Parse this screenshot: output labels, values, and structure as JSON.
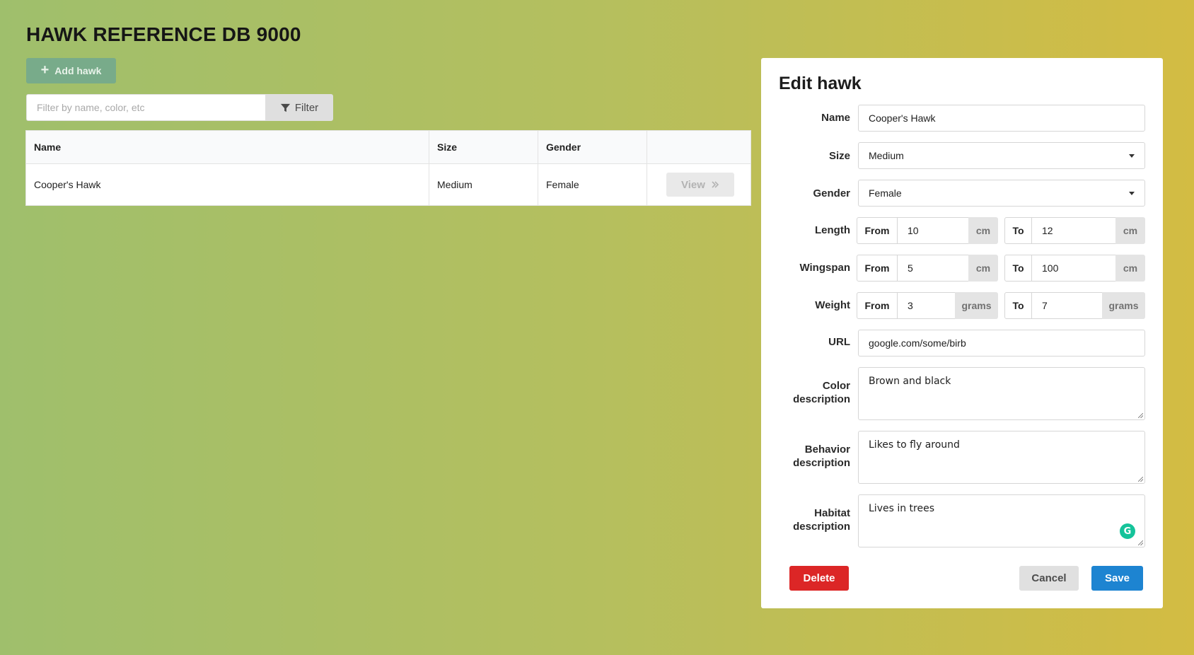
{
  "app": {
    "title": "HAWK REFERENCE DB 9000"
  },
  "toolbar": {
    "add_label": "Add hawk"
  },
  "filter": {
    "placeholder": "Filter by name, color, etc",
    "button_label": "Filter"
  },
  "table": {
    "headers": [
      "Name",
      "Size",
      "Gender",
      ""
    ],
    "rows": [
      {
        "name": "Cooper's Hawk",
        "size": "Medium",
        "gender": "Female",
        "action": "View"
      }
    ]
  },
  "edit": {
    "title": "Edit hawk",
    "labels": {
      "name": "Name",
      "size": "Size",
      "gender": "Gender",
      "length": "Length",
      "wingspan": "Wingspan",
      "weight": "Weight",
      "url": "URL",
      "color_1": "Color",
      "color_2": "description",
      "behavior_1": "Behavior",
      "behavior_2": "description",
      "habitat_1": "Habitat",
      "habitat_2": "description"
    },
    "range_labels": {
      "from": "From",
      "to": "To"
    },
    "values": {
      "name": "Cooper's Hawk",
      "size": "Medium",
      "gender": "Female",
      "length_from": "10",
      "length_to": "12",
      "length_unit": "cm",
      "wingspan_from": "5",
      "wingspan_to": "100",
      "wingspan_unit": "cm",
      "weight_from": "3",
      "weight_to": "7",
      "weight_unit": "grams",
      "url": "google.com/some/birb",
      "color_description": "Brown and black",
      "behavior_description": "Likes to fly around",
      "habitat_description": "Lives in trees"
    },
    "buttons": {
      "delete": "Delete",
      "cancel": "Cancel",
      "save": "Save"
    }
  },
  "colors": {
    "add_button": "#78ab8a",
    "delete": "#dc2626",
    "save": "#1d84d1",
    "grammarly": "#15c39a"
  },
  "icons": {
    "add": "plus-icon",
    "filter": "funnel-icon",
    "view": "double-chevron-right-icon",
    "dropdown": "caret-down-icon",
    "grammarly": "grammarly-icon"
  },
  "grammarly": {
    "glyph": "G"
  }
}
